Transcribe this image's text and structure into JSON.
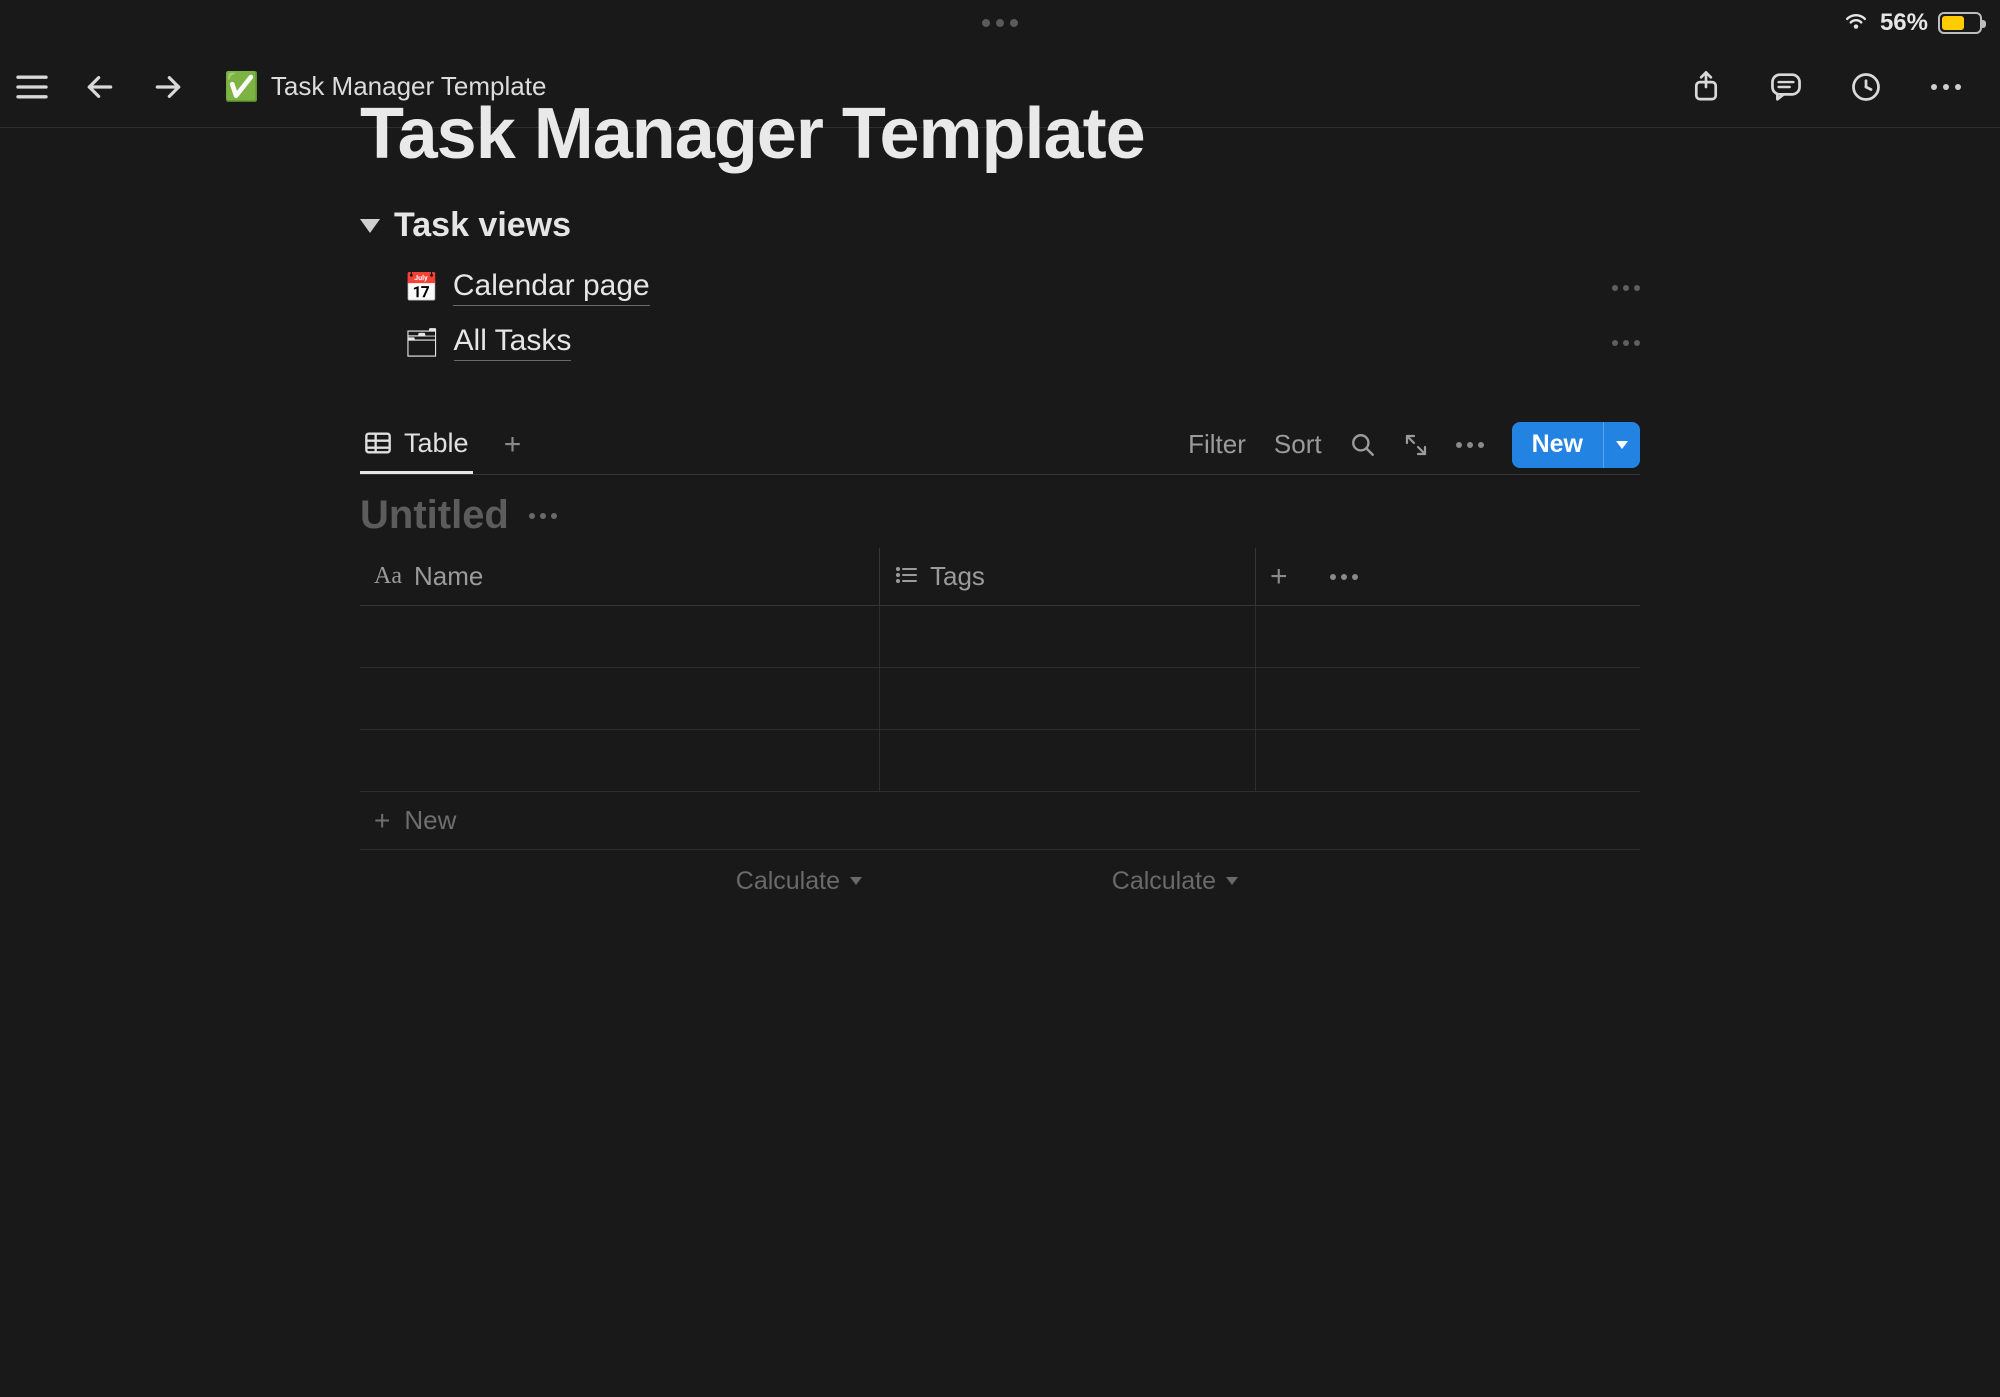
{
  "status": {
    "battery_percent": "56%",
    "battery_fill_pct": 56
  },
  "breadcrumb": {
    "icon": "✅",
    "title": "Task Manager Template"
  },
  "page": {
    "title": "Task Manager Template",
    "toggle_heading": "Task views",
    "links": [
      {
        "icon": "📅",
        "label": "Calendar page"
      },
      {
        "icon": "🗂",
        "label": "All Tasks"
      }
    ]
  },
  "database": {
    "tabs": [
      {
        "label": "Table",
        "active": true
      }
    ],
    "toolbar": {
      "filter": "Filter",
      "sort": "Sort",
      "new_label": "New"
    },
    "title": "Untitled",
    "columns": {
      "name": "Name",
      "tags": "Tags"
    },
    "rows": [
      {},
      {},
      {}
    ],
    "new_row_label": "New",
    "calculate_label": "Calculate"
  }
}
